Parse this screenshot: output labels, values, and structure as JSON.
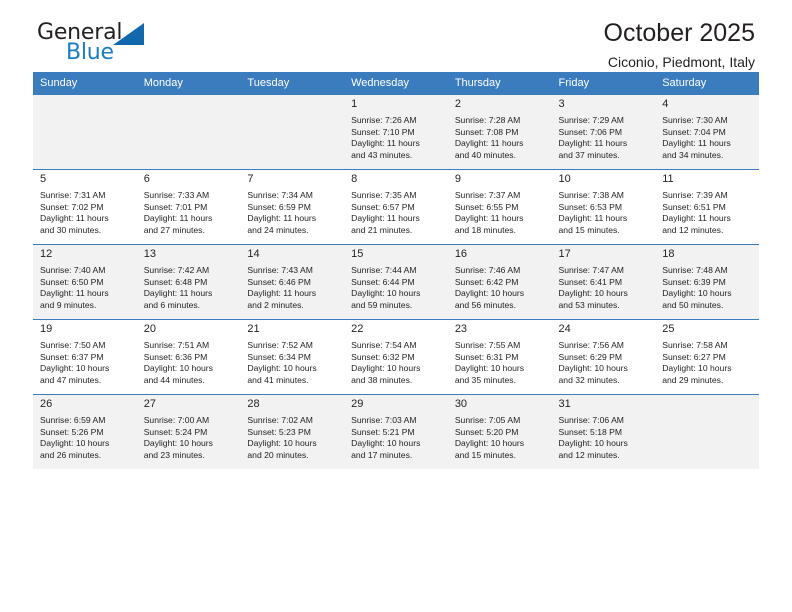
{
  "brand": {
    "name_top": "General",
    "name_bottom": "Blue",
    "triangle_color": "#1267ad",
    "blue_color": "#1a7fc1",
    "dark_color": "#231f20"
  },
  "header": {
    "title": "October 2025",
    "location": "Ciconio, Piedmont, Italy"
  },
  "theme": {
    "header_row_bg": "#3a7cbe",
    "header_row_text": "#ffffff",
    "shaded_row_bg": "#f2f2f2",
    "cell_border": "#3a7cbe"
  },
  "weekdays": [
    "Sunday",
    "Monday",
    "Tuesday",
    "Wednesday",
    "Thursday",
    "Friday",
    "Saturday"
  ],
  "weeks": [
    [
      {
        "day": "",
        "sunrise": "",
        "sunset": "",
        "daylight_1": "",
        "daylight_2": ""
      },
      {
        "day": "",
        "sunrise": "",
        "sunset": "",
        "daylight_1": "",
        "daylight_2": ""
      },
      {
        "day": "",
        "sunrise": "",
        "sunset": "",
        "daylight_1": "",
        "daylight_2": ""
      },
      {
        "day": "1",
        "sunrise": "Sunrise: 7:26 AM",
        "sunset": "Sunset: 7:10 PM",
        "daylight_1": "Daylight: 11 hours",
        "daylight_2": "and 43 minutes."
      },
      {
        "day": "2",
        "sunrise": "Sunrise: 7:28 AM",
        "sunset": "Sunset: 7:08 PM",
        "daylight_1": "Daylight: 11 hours",
        "daylight_2": "and 40 minutes."
      },
      {
        "day": "3",
        "sunrise": "Sunrise: 7:29 AM",
        "sunset": "Sunset: 7:06 PM",
        "daylight_1": "Daylight: 11 hours",
        "daylight_2": "and 37 minutes."
      },
      {
        "day": "4",
        "sunrise": "Sunrise: 7:30 AM",
        "sunset": "Sunset: 7:04 PM",
        "daylight_1": "Daylight: 11 hours",
        "daylight_2": "and 34 minutes."
      }
    ],
    [
      {
        "day": "5",
        "sunrise": "Sunrise: 7:31 AM",
        "sunset": "Sunset: 7:02 PM",
        "daylight_1": "Daylight: 11 hours",
        "daylight_2": "and 30 minutes."
      },
      {
        "day": "6",
        "sunrise": "Sunrise: 7:33 AM",
        "sunset": "Sunset: 7:01 PM",
        "daylight_1": "Daylight: 11 hours",
        "daylight_2": "and 27 minutes."
      },
      {
        "day": "7",
        "sunrise": "Sunrise: 7:34 AM",
        "sunset": "Sunset: 6:59 PM",
        "daylight_1": "Daylight: 11 hours",
        "daylight_2": "and 24 minutes."
      },
      {
        "day": "8",
        "sunrise": "Sunrise: 7:35 AM",
        "sunset": "Sunset: 6:57 PM",
        "daylight_1": "Daylight: 11 hours",
        "daylight_2": "and 21 minutes."
      },
      {
        "day": "9",
        "sunrise": "Sunrise: 7:37 AM",
        "sunset": "Sunset: 6:55 PM",
        "daylight_1": "Daylight: 11 hours",
        "daylight_2": "and 18 minutes."
      },
      {
        "day": "10",
        "sunrise": "Sunrise: 7:38 AM",
        "sunset": "Sunset: 6:53 PM",
        "daylight_1": "Daylight: 11 hours",
        "daylight_2": "and 15 minutes."
      },
      {
        "day": "11",
        "sunrise": "Sunrise: 7:39 AM",
        "sunset": "Sunset: 6:51 PM",
        "daylight_1": "Daylight: 11 hours",
        "daylight_2": "and 12 minutes."
      }
    ],
    [
      {
        "day": "12",
        "sunrise": "Sunrise: 7:40 AM",
        "sunset": "Sunset: 6:50 PM",
        "daylight_1": "Daylight: 11 hours",
        "daylight_2": "and 9 minutes."
      },
      {
        "day": "13",
        "sunrise": "Sunrise: 7:42 AM",
        "sunset": "Sunset: 6:48 PM",
        "daylight_1": "Daylight: 11 hours",
        "daylight_2": "and 6 minutes."
      },
      {
        "day": "14",
        "sunrise": "Sunrise: 7:43 AM",
        "sunset": "Sunset: 6:46 PM",
        "daylight_1": "Daylight: 11 hours",
        "daylight_2": "and 2 minutes."
      },
      {
        "day": "15",
        "sunrise": "Sunrise: 7:44 AM",
        "sunset": "Sunset: 6:44 PM",
        "daylight_1": "Daylight: 10 hours",
        "daylight_2": "and 59 minutes."
      },
      {
        "day": "16",
        "sunrise": "Sunrise: 7:46 AM",
        "sunset": "Sunset: 6:42 PM",
        "daylight_1": "Daylight: 10 hours",
        "daylight_2": "and 56 minutes."
      },
      {
        "day": "17",
        "sunrise": "Sunrise: 7:47 AM",
        "sunset": "Sunset: 6:41 PM",
        "daylight_1": "Daylight: 10 hours",
        "daylight_2": "and 53 minutes."
      },
      {
        "day": "18",
        "sunrise": "Sunrise: 7:48 AM",
        "sunset": "Sunset: 6:39 PM",
        "daylight_1": "Daylight: 10 hours",
        "daylight_2": "and 50 minutes."
      }
    ],
    [
      {
        "day": "19",
        "sunrise": "Sunrise: 7:50 AM",
        "sunset": "Sunset: 6:37 PM",
        "daylight_1": "Daylight: 10 hours",
        "daylight_2": "and 47 minutes."
      },
      {
        "day": "20",
        "sunrise": "Sunrise: 7:51 AM",
        "sunset": "Sunset: 6:36 PM",
        "daylight_1": "Daylight: 10 hours",
        "daylight_2": "and 44 minutes."
      },
      {
        "day": "21",
        "sunrise": "Sunrise: 7:52 AM",
        "sunset": "Sunset: 6:34 PM",
        "daylight_1": "Daylight: 10 hours",
        "daylight_2": "and 41 minutes."
      },
      {
        "day": "22",
        "sunrise": "Sunrise: 7:54 AM",
        "sunset": "Sunset: 6:32 PM",
        "daylight_1": "Daylight: 10 hours",
        "daylight_2": "and 38 minutes."
      },
      {
        "day": "23",
        "sunrise": "Sunrise: 7:55 AM",
        "sunset": "Sunset: 6:31 PM",
        "daylight_1": "Daylight: 10 hours",
        "daylight_2": "and 35 minutes."
      },
      {
        "day": "24",
        "sunrise": "Sunrise: 7:56 AM",
        "sunset": "Sunset: 6:29 PM",
        "daylight_1": "Daylight: 10 hours",
        "daylight_2": "and 32 minutes."
      },
      {
        "day": "25",
        "sunrise": "Sunrise: 7:58 AM",
        "sunset": "Sunset: 6:27 PM",
        "daylight_1": "Daylight: 10 hours",
        "daylight_2": "and 29 minutes."
      }
    ],
    [
      {
        "day": "26",
        "sunrise": "Sunrise: 6:59 AM",
        "sunset": "Sunset: 5:26 PM",
        "daylight_1": "Daylight: 10 hours",
        "daylight_2": "and 26 minutes."
      },
      {
        "day": "27",
        "sunrise": "Sunrise: 7:00 AM",
        "sunset": "Sunset: 5:24 PM",
        "daylight_1": "Daylight: 10 hours",
        "daylight_2": "and 23 minutes."
      },
      {
        "day": "28",
        "sunrise": "Sunrise: 7:02 AM",
        "sunset": "Sunset: 5:23 PM",
        "daylight_1": "Daylight: 10 hours",
        "daylight_2": "and 20 minutes."
      },
      {
        "day": "29",
        "sunrise": "Sunrise: 7:03 AM",
        "sunset": "Sunset: 5:21 PM",
        "daylight_1": "Daylight: 10 hours",
        "daylight_2": "and 17 minutes."
      },
      {
        "day": "30",
        "sunrise": "Sunrise: 7:05 AM",
        "sunset": "Sunset: 5:20 PM",
        "daylight_1": "Daylight: 10 hours",
        "daylight_2": "and 15 minutes."
      },
      {
        "day": "31",
        "sunrise": "Sunrise: 7:06 AM",
        "sunset": "Sunset: 5:18 PM",
        "daylight_1": "Daylight: 10 hours",
        "daylight_2": "and 12 minutes."
      },
      {
        "day": "",
        "sunrise": "",
        "sunset": "",
        "daylight_1": "",
        "daylight_2": ""
      }
    ]
  ]
}
